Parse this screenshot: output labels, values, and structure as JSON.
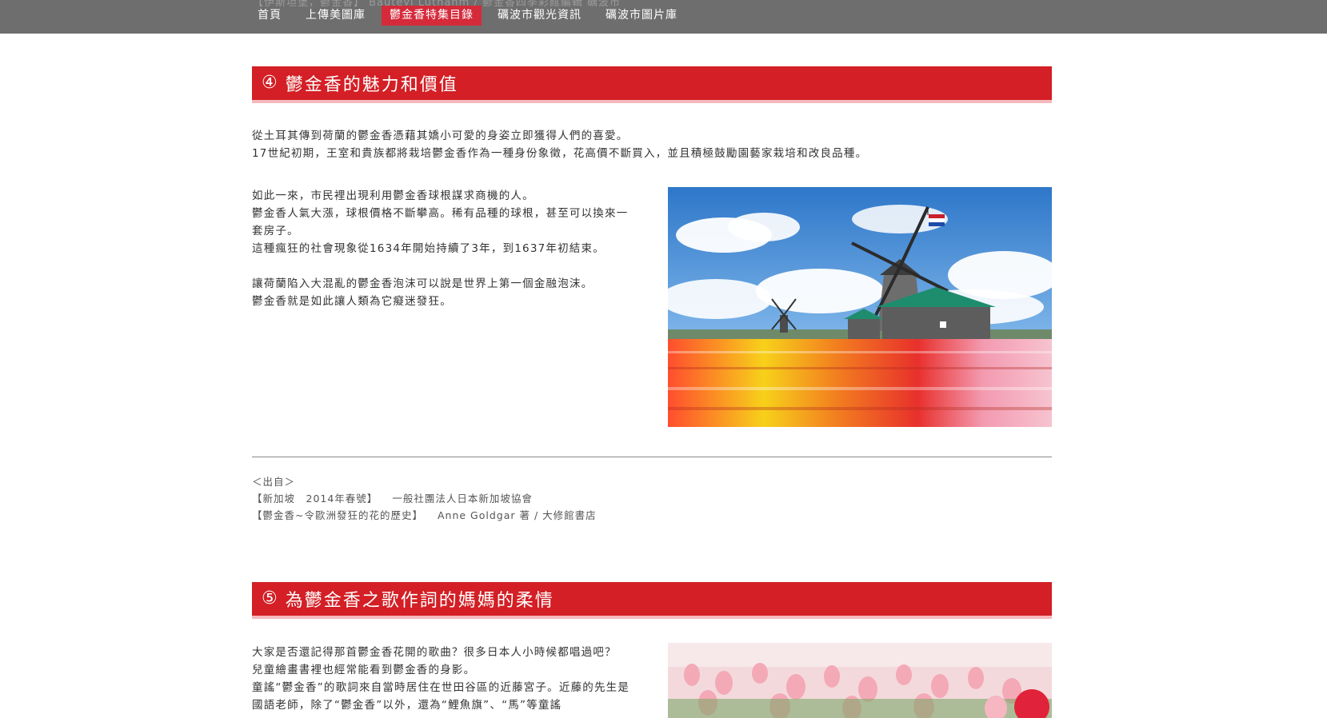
{
  "topbar": {
    "ghost_text": "【伊斯坦堡，鬱金香】  Bauteyl Luthanm / 鬱金香四季彩館編輯  礪波市",
    "nav": [
      {
        "label": "首頁",
        "active": false
      },
      {
        "label": "上傳美圖庫",
        "active": false
      },
      {
        "label": "鬱金香特集目錄",
        "active": true
      },
      {
        "label": "礪波市觀光資訊",
        "active": false
      },
      {
        "label": "礪波市圖片庫",
        "active": false
      }
    ]
  },
  "section4": {
    "number": "④",
    "title": "鬱金香的魅力和價值",
    "intro": [
      "從土耳其傳到荷蘭的鬱金香憑藉其嬌小可愛的身姿立即獲得人們的喜愛。",
      "17世紀初期，王室和貴族都將栽培鬱金香作為一種身份象徵，花高價不斷買入，並且積極鼓勵園藝家栽培和改良品種。"
    ],
    "body": [
      "如此一來，市民裡出現利用鬱金香球根謀求商機的人。",
      "鬱金香人氣大漲，球根價格不斷攀高。稀有品種的球根，甚至可以換來一套房子。",
      "這種瘋狂的社會現象從1634年開始持續了3年，到1637年初結束。",
      "",
      "讓荷蘭陷入大混亂的鬱金香泡沫可以說是世界上第一個金融泡沫。",
      "鬱金香就是如此讓人類為它癡迷發狂。"
    ],
    "image_name": "windmill-tulip-field-photo"
  },
  "sources": {
    "heading": "＜出自＞",
    "lines": [
      {
        "book": "【新加坡　2014年春號】",
        "publisher": "一般社團法人日本新加坡協會"
      },
      {
        "book": "【鬱金香~令歐洲發狂的花的歷史】",
        "publisher": "Anne Goldgar 著 / 大修館書店"
      }
    ]
  },
  "section5": {
    "number": "⑤",
    "title": "為鬱金香之歌作詞的媽媽的柔情",
    "body": [
      "大家是否還記得那首鬱金香花開的歌曲？很多日本人小時候都唱過吧？",
      "兒童繪畫書裡也經常能看到鬱金香的身影。",
      "童謠“鬱金香”的歌詞來自當時居住在世田谷區的近藤宮子。近藤的先生是國語老師，除了“鬱金香”以外，還為“鯉魚旗”、“馬”等童謠"
    ],
    "image_name": "pink-tulips-photo"
  },
  "colors": {
    "header_red": "#d31f25",
    "nav_active": "#d52a3a",
    "topbar_gray": "#6e6e6e"
  }
}
